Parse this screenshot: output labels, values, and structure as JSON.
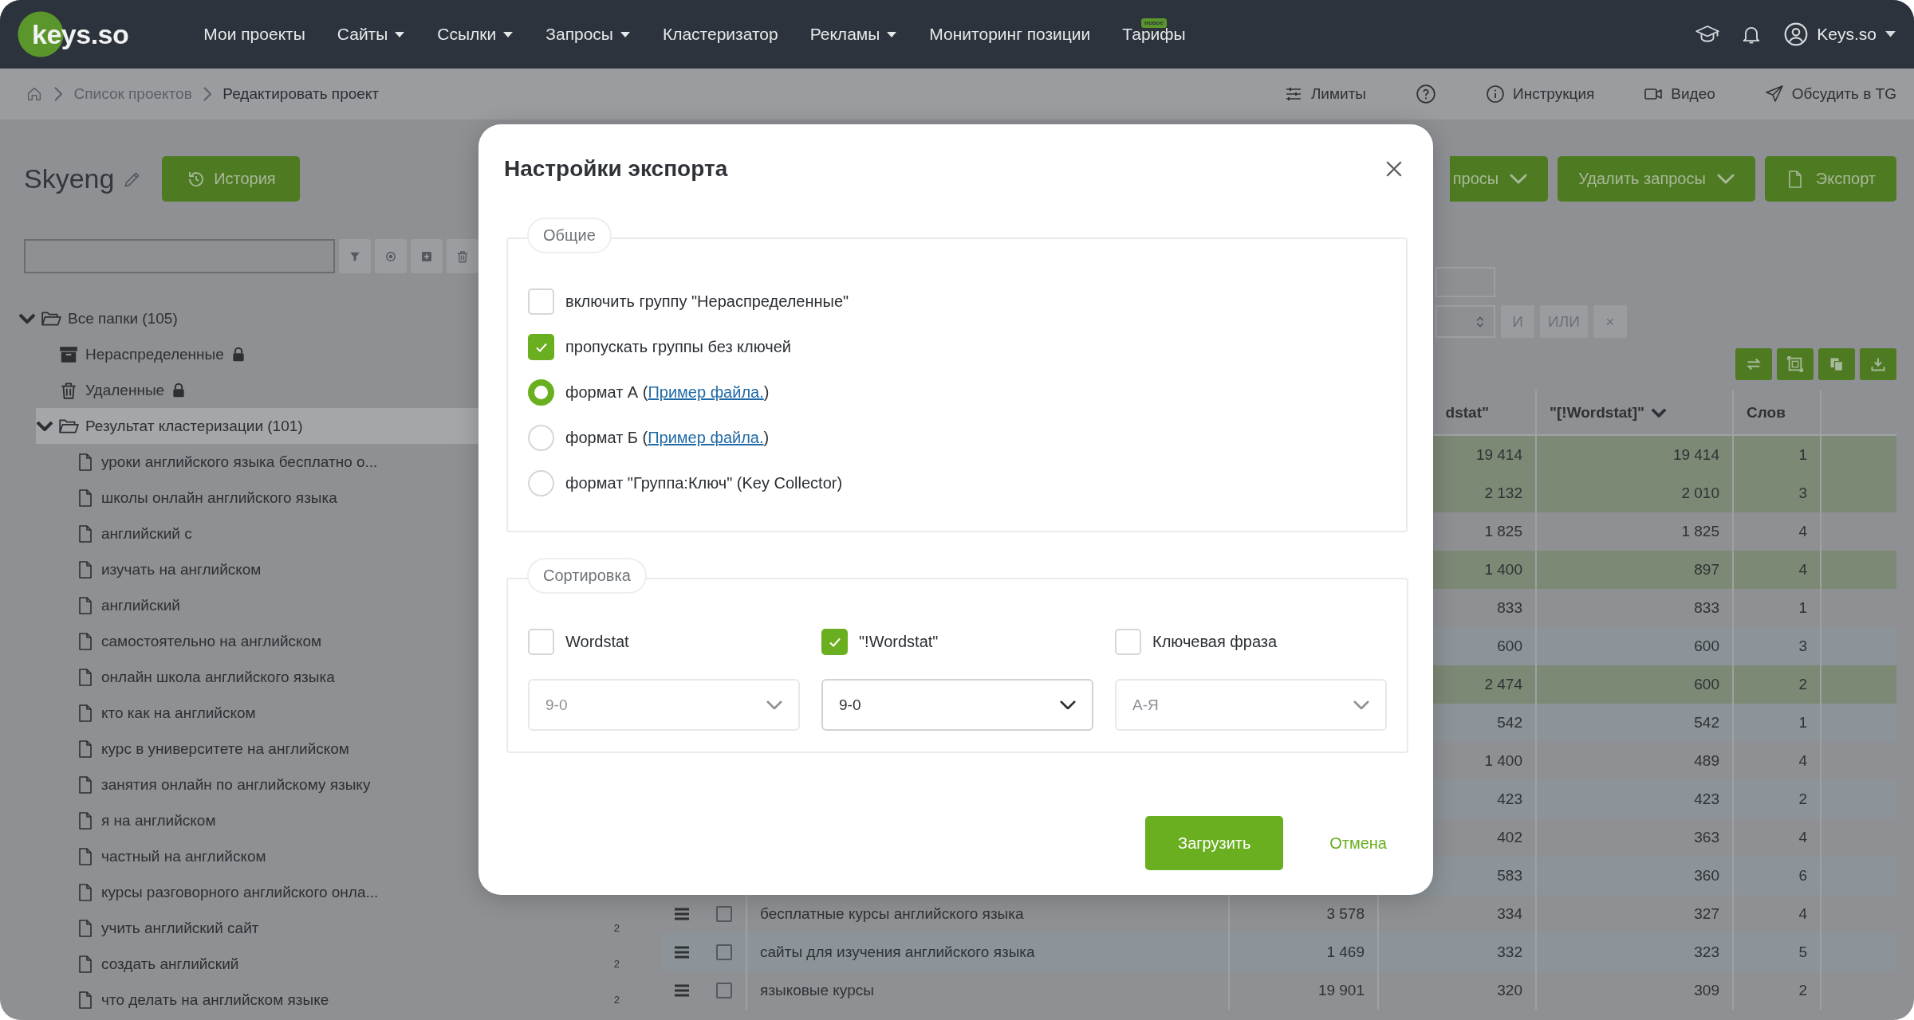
{
  "topnav": {
    "logo": "keys.so",
    "items": [
      {
        "label": "Мои проекты",
        "dropdown": false
      },
      {
        "label": "Сайты",
        "dropdown": true
      },
      {
        "label": "Ссылки",
        "dropdown": true
      },
      {
        "label": "Запросы",
        "dropdown": true
      },
      {
        "label": "Кластеризатор",
        "dropdown": false
      },
      {
        "label": "Рекламы",
        "dropdown": true
      },
      {
        "label": "Мониторинг позиции",
        "dropdown": false
      },
      {
        "label": "Тарифы",
        "dropdown": false,
        "badge": "новое"
      }
    ],
    "user": "Keys.so"
  },
  "breadcrumbs": {
    "items": [
      {
        "label": "Список проектов",
        "current": false
      },
      {
        "label": "Редактировать проект",
        "current": true
      }
    ],
    "tools": [
      {
        "kind": "limits",
        "label": "Лимиты"
      },
      {
        "kind": "help"
      },
      {
        "kind": "info",
        "label": "Инструкция"
      },
      {
        "kind": "video",
        "label": "Видео"
      },
      {
        "kind": "send",
        "label": "Обсудить в TG"
      }
    ]
  },
  "project": {
    "name": "Skyeng",
    "history_button": "История"
  },
  "tree": [
    {
      "label": "Все папки (105)",
      "kind": "folder",
      "expanded": true,
      "selected": false,
      "children": [
        {
          "label": "Нераспределенные",
          "kind": "archive",
          "locked": true,
          "selected": false
        },
        {
          "label": "Удаленные",
          "kind": "trash",
          "locked": true,
          "selected": false
        },
        {
          "label": "Результат кластеризации (101)",
          "kind": "folder",
          "locked": false,
          "expanded": true,
          "selected": true,
          "children": [
            {
              "label": "уроки английского языка бесплатно о...",
              "kind": "file",
              "selected": false
            },
            {
              "label": "школы онлайн английского языка",
              "kind": "file",
              "selected": false
            },
            {
              "label": "английский с",
              "kind": "file",
              "selected": false
            },
            {
              "label": "изучать на английском",
              "kind": "file",
              "selected": false
            },
            {
              "label": "английский",
              "kind": "file",
              "selected": false
            },
            {
              "label": "самостоятельно на английском",
              "kind": "file",
              "selected": false
            },
            {
              "label": "онлайн школа английского языка",
              "kind": "file",
              "selected": false
            },
            {
              "label": "кто как на английском",
              "kind": "file",
              "selected": false
            },
            {
              "label": "курс в университете на английском",
              "kind": "file",
              "selected": false
            },
            {
              "label": "занятия онлайн по английскому языку",
              "kind": "file",
              "selected": false
            },
            {
              "label": "я на английском",
              "kind": "file",
              "selected": false
            },
            {
              "label": "частный на английском",
              "kind": "file",
              "selected": false
            },
            {
              "label": "курсы разговорного английского онла...",
              "kind": "file",
              "selected": false
            },
            {
              "label": "учить английский сайт",
              "kind": "file",
              "selected": false,
              "count": "2"
            },
            {
              "label": "создать английский",
              "kind": "file",
              "selected": false,
              "count": "2"
            },
            {
              "label": "что делать на английском языке",
              "kind": "file",
              "selected": false,
              "count": "2"
            }
          ]
        }
      ]
    }
  ],
  "actions": [
    {
      "label": "просы",
      "kind": "dropdown"
    },
    {
      "label": "Удалить запросы",
      "kind": "dropdown"
    },
    {
      "label": "Экспорт",
      "kind": "file"
    }
  ],
  "filter": {
    "logic_buttons": [
      "И",
      "ИЛИ",
      "×"
    ]
  },
  "table": {
    "columns": [
      {
        "label": "dstat\"",
        "sorted": false
      },
      {
        "label": "\"[!Wordstat]\"",
        "sorted": true
      },
      {
        "label": "Слов",
        "sorted": false
      }
    ],
    "rows": [
      {
        "highlighted": true,
        "values": [
          "19 414",
          "19 414",
          "1"
        ]
      },
      {
        "highlighted": true,
        "values": [
          "2 132",
          "2 010",
          "3"
        ]
      },
      {
        "highlighted": false,
        "values": [
          "1 825",
          "1 825",
          "4"
        ]
      },
      {
        "highlighted": true,
        "values": [
          "1 400",
          "897",
          "4"
        ]
      },
      {
        "highlighted": false,
        "values": [
          "833",
          "833",
          "1"
        ]
      },
      {
        "highlighted": false,
        "values": [
          "600",
          "600",
          "3"
        ]
      },
      {
        "highlighted": true,
        "values": [
          "2 474",
          "600",
          "2"
        ]
      },
      {
        "highlighted": false,
        "values": [
          "542",
          "542",
          "1"
        ]
      },
      {
        "highlighted": false,
        "values": [
          "1 400",
          "489",
          "4"
        ]
      },
      {
        "highlighted": false,
        "values": [
          "423",
          "423",
          "2"
        ]
      },
      {
        "highlighted": false,
        "values": [
          "402",
          "363",
          "4"
        ]
      },
      {
        "highlighted": false,
        "values": [
          "583",
          "360",
          "6"
        ]
      },
      {
        "highlighted": false,
        "checked": false,
        "column_1": "бесплатные курсы английского языка",
        "column_2": "3 578",
        "values": [
          "334",
          "327",
          "4"
        ]
      },
      {
        "highlighted": false,
        "checked": false,
        "column_1": "сайты для изучения английского языка",
        "column_2": "1 469",
        "values": [
          "332",
          "323",
          "5"
        ]
      },
      {
        "highlighted": false,
        "checked": false,
        "column_1": "языковые курсы",
        "column_2": "19 901",
        "values": [
          "320",
          "309",
          "2"
        ]
      }
    ]
  },
  "modal": {
    "title": "Настройки экспорта",
    "general": {
      "legend": "Общие",
      "options": [
        {
          "kind": "checkbox",
          "label": "включить группу \"Нераспределенные\"",
          "checked": false
        },
        {
          "kind": "checkbox",
          "label": "пропускать группы без ключей",
          "checked": true
        },
        {
          "kind": "radio",
          "label": "формат А (",
          "link": "Пример файла.",
          "suffix": ")",
          "selected": true
        },
        {
          "kind": "radio",
          "label": "формат Б (",
          "link": "Пример файла.",
          "suffix": ")",
          "selected": false
        },
        {
          "kind": "radio",
          "label": "формат \"Группа:Ключ\" (Key Collector)",
          "selected": false
        }
      ]
    },
    "sorting": {
      "legend": "Сортировка",
      "fields": [
        {
          "label": "Wordstat",
          "checked": false,
          "value": "9-0",
          "disabled": true
        },
        {
          "label": "\"!Wordstat\"",
          "checked": true,
          "value": "9-0",
          "disabled": false
        },
        {
          "label": "Ключевая фраза",
          "checked": false,
          "value": "А-Я",
          "disabled": true
        }
      ]
    },
    "buttons": [
      {
        "label": "Загрузить",
        "kind": "primary"
      },
      {
        "label": "Отмена",
        "kind": "link"
      }
    ]
  }
}
